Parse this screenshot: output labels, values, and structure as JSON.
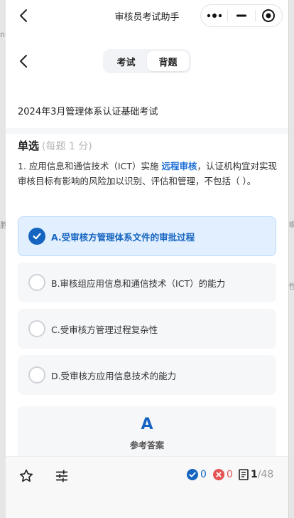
{
  "window": {
    "title": "审核员考试助手",
    "edge_fragments": [
      "nu",
      "啊",
      "胞",
      "性"
    ]
  },
  "header": {
    "tabs": [
      {
        "label": "考试",
        "active": false
      },
      {
        "label": "背题",
        "active": true
      }
    ]
  },
  "exam": {
    "title": "2024年3月管理体系认证基础考试"
  },
  "question": {
    "type_label": "单选",
    "score_note": "(每题 1 分)",
    "text_before": "1. 应用信息和通信技术（ICT）实施 ",
    "highlight": "远程审核",
    "text_after": "，认证机构宜对实现审核目标有影响的风险加以识别、评估和管理，不包括（ ）。",
    "options": [
      {
        "text": "A.受审核方管理体系文件的审批过程",
        "selected": true
      },
      {
        "text": "B.审核组应用信息和通信技术（ICT）的能力",
        "selected": false
      },
      {
        "text": "C.受审核方管理过程复杂性",
        "selected": false
      },
      {
        "text": "D.受审核方应用信息技术的能力",
        "selected": false
      }
    ]
  },
  "answer": {
    "letter": "A",
    "label": "参考答案"
  },
  "bottom": {
    "correct_count": "0",
    "wrong_count": "0",
    "current": "1",
    "total": "/48"
  },
  "colors": {
    "accent": "#1565c0",
    "selected_bg": "#e2efff",
    "wrong": "#e45454",
    "highlight": "#1f6fd6"
  },
  "icons": [
    "back-icon",
    "more-dots-icon",
    "minimize-icon",
    "close-target-icon",
    "check-icon",
    "star-icon",
    "settings-sliders-icon",
    "correct-icon",
    "wrong-icon",
    "answer-sheet-icon"
  ]
}
